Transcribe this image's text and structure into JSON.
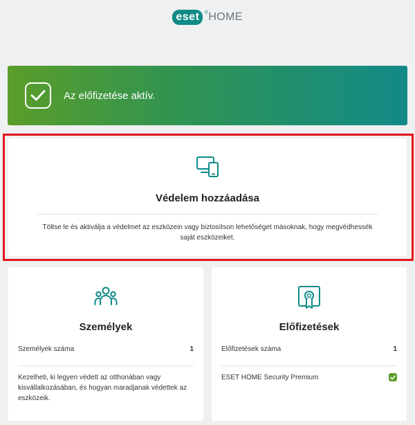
{
  "header": {
    "logo_text": "eset",
    "logo_reg": "®",
    "product": "HOME"
  },
  "colors": {
    "accent": "#0f8a87",
    "success": "#5b9e2b",
    "highlight": "#e3141b",
    "banner_gradient": [
      "#5a9d2a",
      "#138a88"
    ]
  },
  "banner": {
    "icon": "checkmark-icon",
    "text": "Az előfizetése aktív."
  },
  "add_protection": {
    "icon": "devices-icon",
    "title": "Védelem hozzáadása",
    "description": "Töltse le és aktiválja a védelmet az eszközein vagy biztosítson lehetőséget másoknak, hogy megvédhessék saját eszközeiket."
  },
  "people": {
    "icon": "people-icon",
    "title": "Személyek",
    "count_label": "Személyek száma",
    "count_value": "1",
    "description": "Kezelheti, ki legyen védett az otthonában vagy kisvállalkozásában, és hogyan maradjanak védettek az eszközeik."
  },
  "subscriptions": {
    "icon": "certificate-icon",
    "title": "Előfizetések",
    "count_label": "Előfizetések száma",
    "count_value": "1",
    "item_name": "ESET HOME Security Premium",
    "item_status_icon": "status-ok-icon"
  }
}
